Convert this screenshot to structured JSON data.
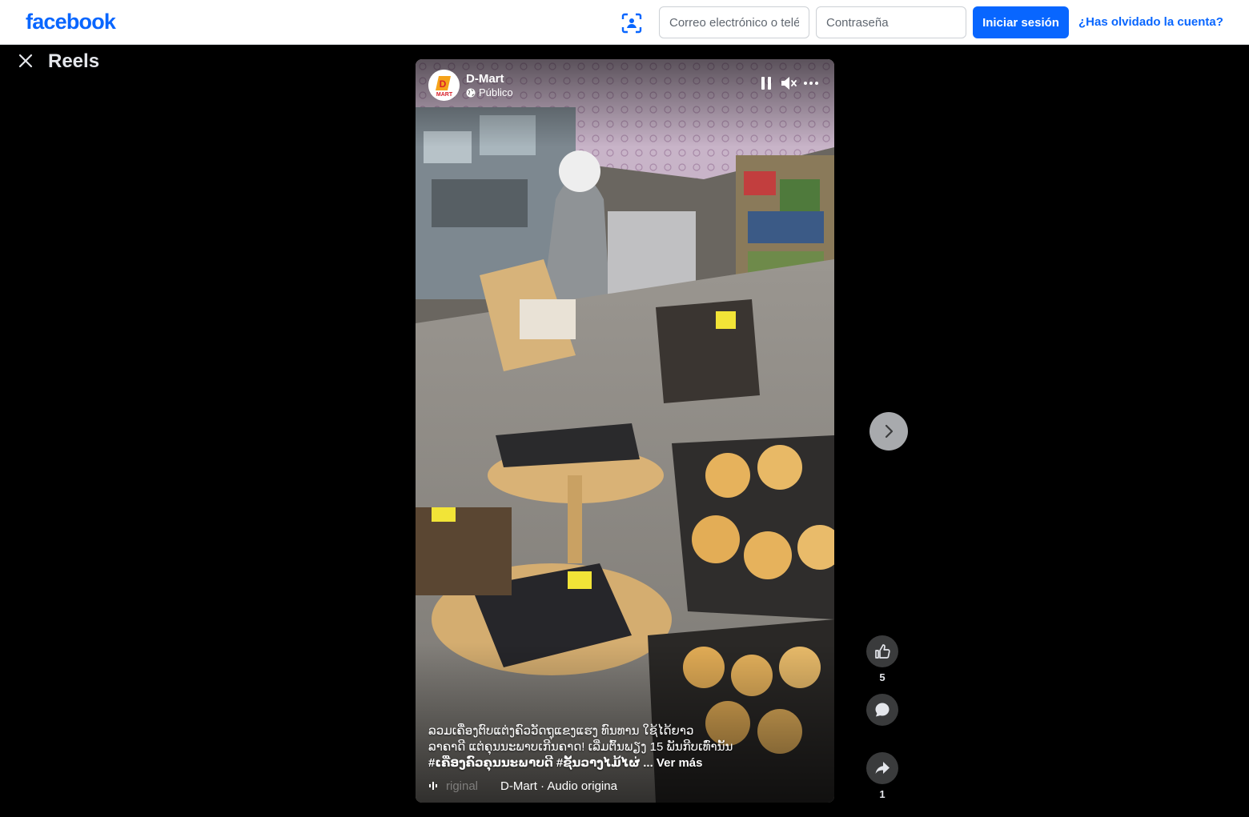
{
  "header": {
    "logo": "facebook",
    "email_placeholder": "Correo electrónico o teléfono",
    "password_placeholder": "Contraseña",
    "login_label": "Iniciar sesión",
    "forgot_label": "¿Has olvidado la cuenta?"
  },
  "viewer": {
    "title": "Reels"
  },
  "reel": {
    "page_name": "D-Mart",
    "privacy": "Público",
    "avatar_text": "MART",
    "caption_line1": "ລວມເຄື່ອງຕົບແຕ່ງຄົວວັດຖຸແຂງແຮງ ທົນທານ ໃຊ້ໄດ້ຍາວ",
    "caption_line2": "ລາຄາດີ ແຕ່ຄຸນນະພາບເກີນຄາດ! ເລີ່ມຕົ້ນພຽງ 15 ພັນກີບເທົ່ານັ້ນ",
    "caption_line3": "#ເຄື່ອງຄົວຄຸນນະພາບດີ #ຊັ້ນວາງໄມ້ໄຜ່",
    "see_more": "... Ver más",
    "audio_faded": "riginal",
    "audio_label": "D-Mart · Audio origina"
  },
  "actions": {
    "like_count": "5",
    "share_count": "1"
  },
  "colors": {
    "brand": "#0866ff",
    "background": "#000000",
    "action_bg": "#3a3b3c"
  },
  "icons": [
    "scan-icon",
    "close-icon",
    "globe-icon",
    "pause-icon",
    "mute-icon",
    "more-icon",
    "audio-wave-icon",
    "chevron-right-icon",
    "like-icon",
    "comment-icon",
    "share-icon"
  ]
}
